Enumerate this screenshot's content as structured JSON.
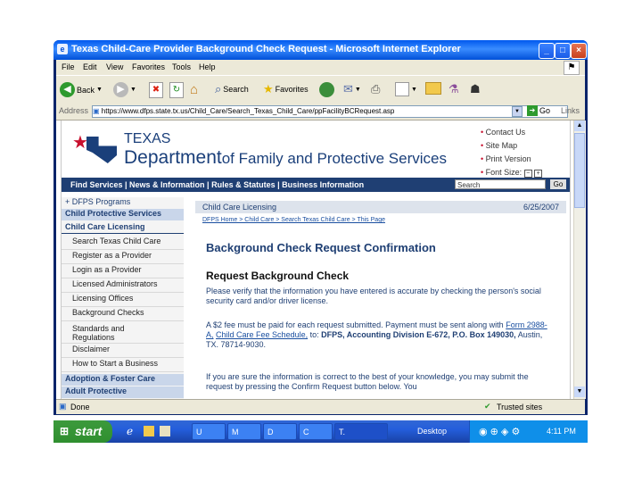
{
  "window": {
    "title": "Texas Child-Care Provider Background Check Request - Microsoft Internet Explorer"
  },
  "menu": [
    "File",
    "Edit",
    "View",
    "Favorites",
    "Tools",
    "Help"
  ],
  "toolbar": {
    "back": "Back",
    "search": "Search",
    "favorites": "Favorites"
  },
  "address": {
    "label": "Address",
    "url": "https://www.dfps.state.tx.us/Child_Care/Search_Texas_Child_Care/ppFacilityBCRequest.asp",
    "go": "Go",
    "links": "Links"
  },
  "site": {
    "logo_state": "TEXAS",
    "logo_dept_part1": "Department",
    "logo_dept_part2": "of Family and Protective Services",
    "top_links": [
      "Contact Us",
      "Site Map",
      "Print Version",
      "Font Size:"
    ],
    "nav": "Find Services | News & Information | Rules & Statutes | Business Information",
    "search_placeholder": "Search",
    "search_go": "Go",
    "sidebar": {
      "dfps_programs": "DFPS Programs",
      "cps": "Child Protective Services",
      "ccl": "Child Care Licensing",
      "items": [
        "Search Texas Child Care",
        "Register as a Provider",
        "Login as a Provider",
        "Licensed Administrators",
        "Licensing Offices",
        "Background Checks",
        "Standards and Regulations",
        "Disclaimer",
        "How to Start a Business"
      ],
      "adoption": "Adoption & Foster Care",
      "adult": "Adult Protective"
    },
    "section_header": "Child Care Licensing",
    "date": "6/25/2007",
    "breadcrumb": "DFPS Home > Child Care > Search Texas Child Care > This Page",
    "page_title": "Background Check Request Confirmation",
    "subtitle": "Request Background Check",
    "para1": "Please verify that the information you have entered is accurate by checking the person's social security card and/or driver license.",
    "para2_a": "A $2 fee must be paid for each request submitted. Payment must be sent along with ",
    "para2_form": "Form 2988-A,",
    "para2_b": " ",
    "para2_link": "Child Care Fee Schedule,",
    "para2_c": " to: ",
    "para2_addr": "DFPS, Accounting Division E-672, P.O. Box 149030,",
    "para2_d": " Austin, TX. 78714-9030.",
    "para3": "If you are sure the information is correct to the best of your knowledge, you may submit the request by pressing the Confirm Request button below. You"
  },
  "status": {
    "left": "Done",
    "zone": "Trusted sites"
  },
  "taskbar": {
    "start": "start",
    "tasks": [
      "U",
      "M",
      "D",
      "C",
      "T."
    ],
    "desktop": "Desktop",
    "clock": "4:11 PM"
  },
  "colors": {
    "accent": "#1a4fa0",
    "nav_bg": "#1f3f73",
    "sidebar_hdr": "#c9d6ea",
    "section_bg": "#dde3ec"
  }
}
